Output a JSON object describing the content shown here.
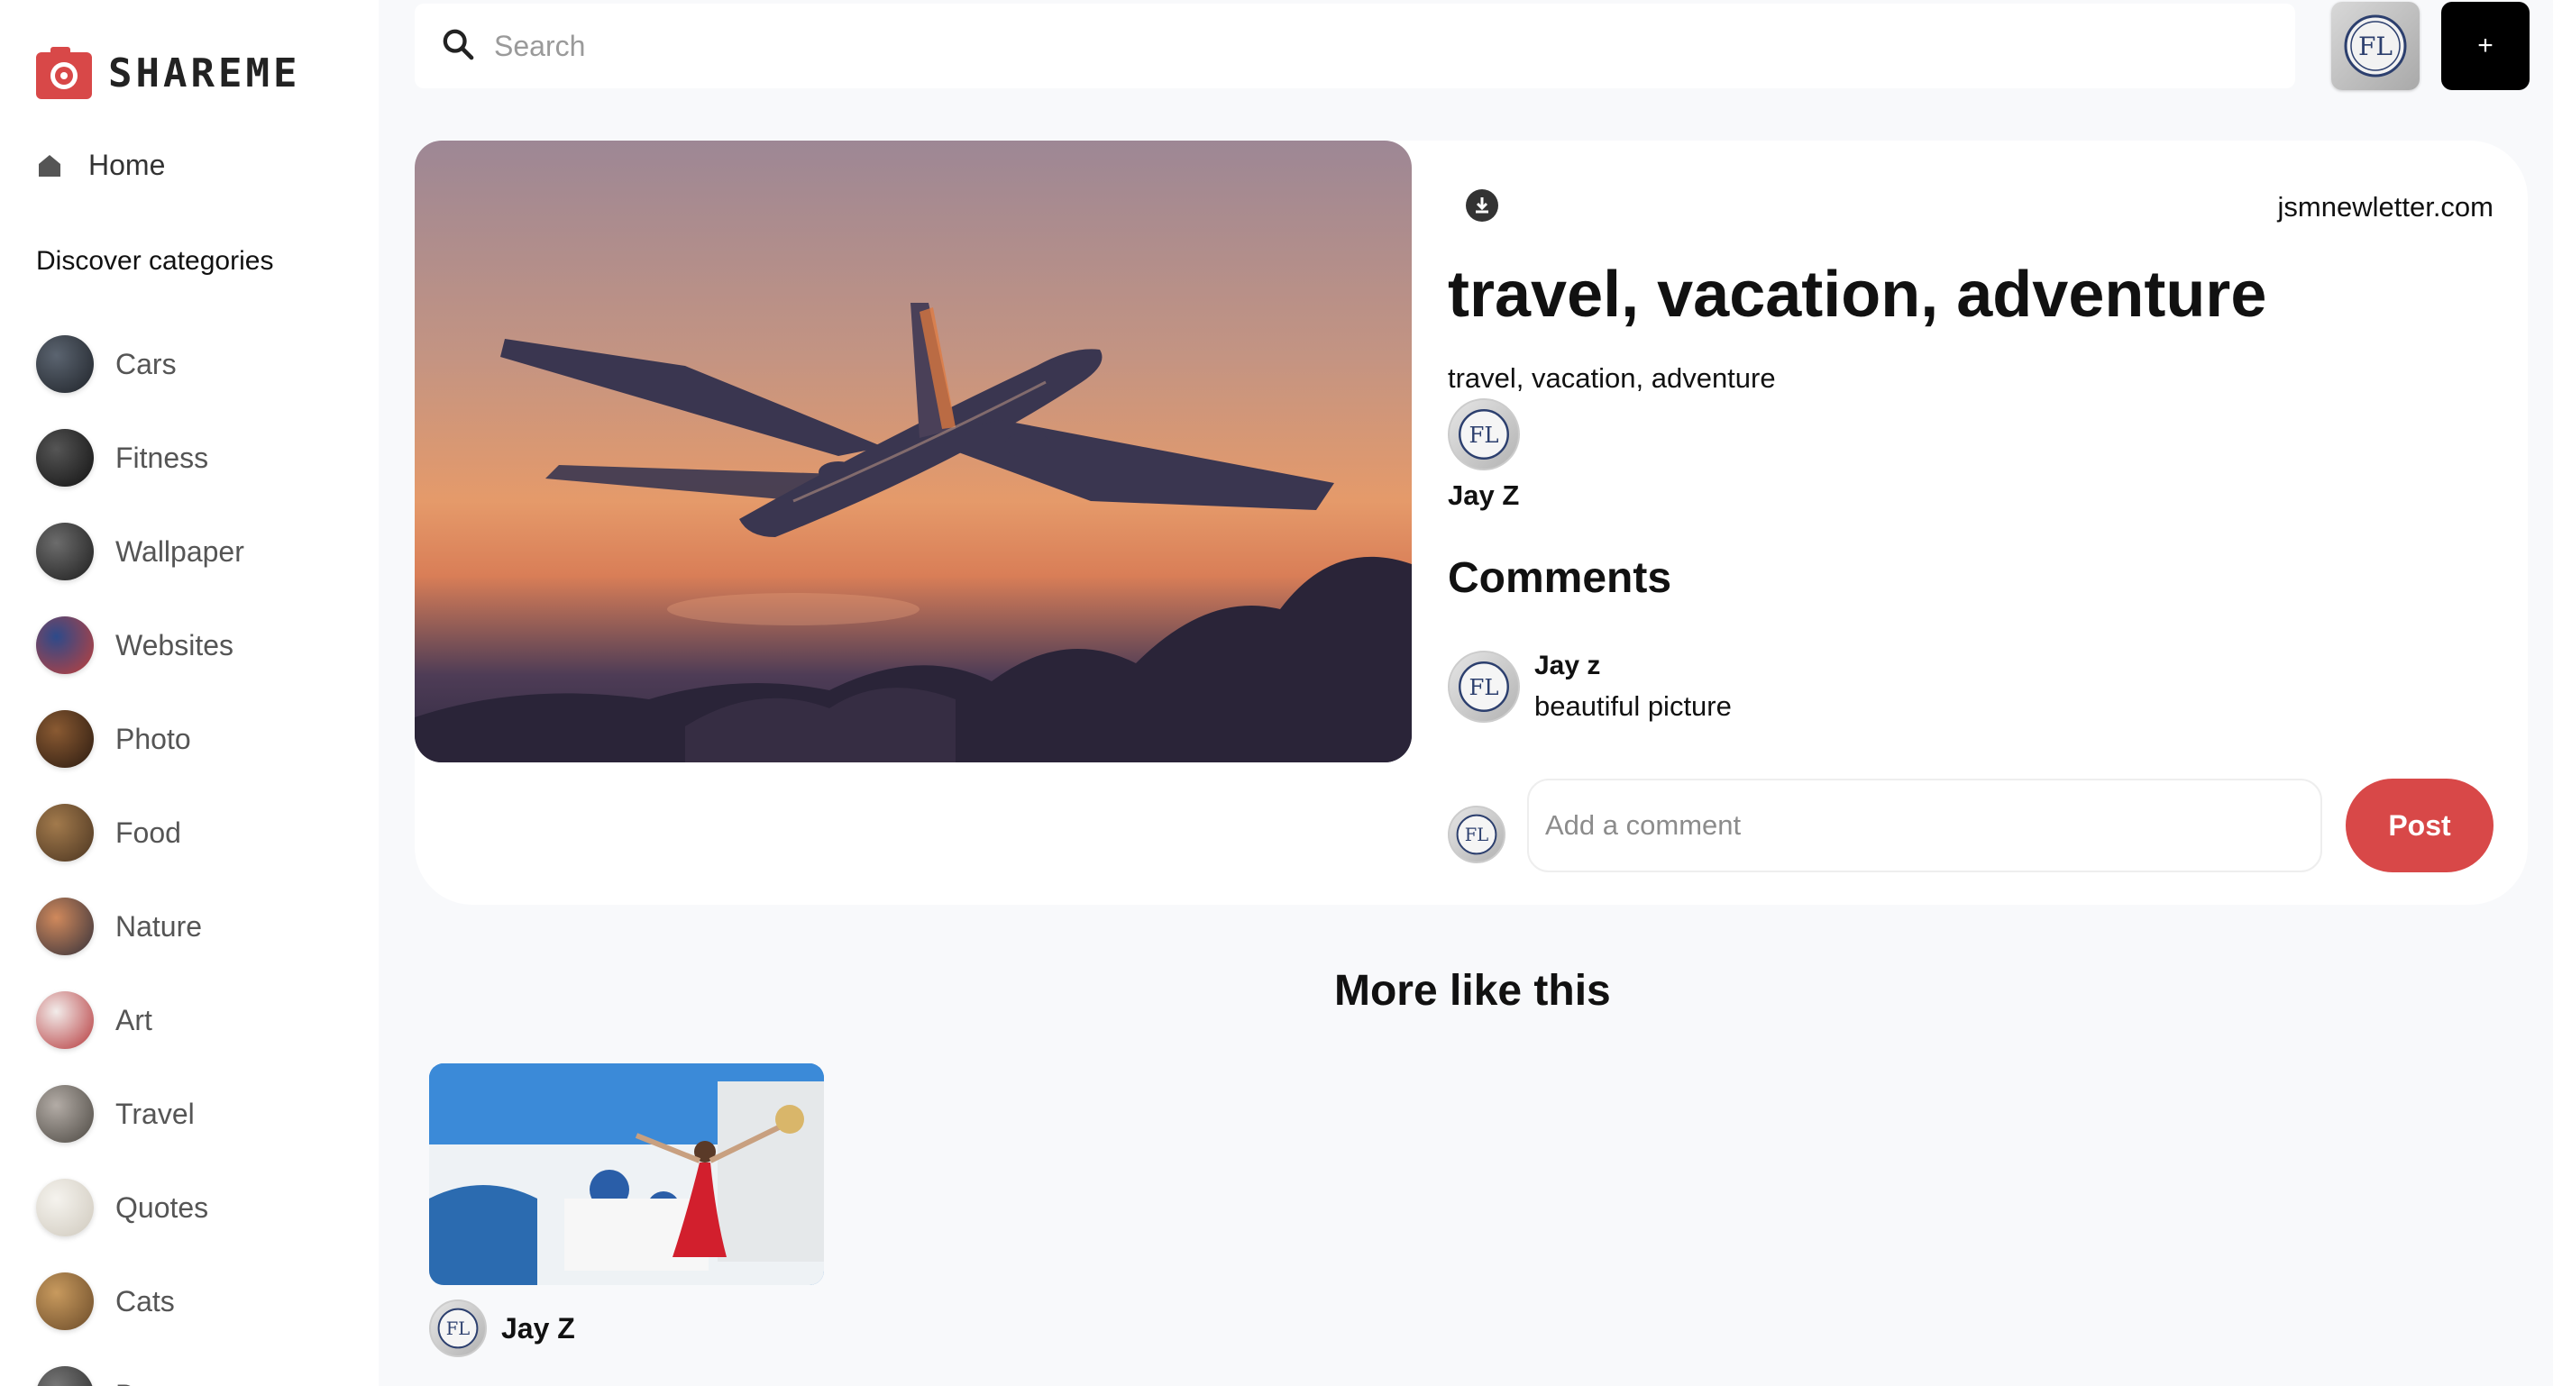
{
  "brand": {
    "name": "SHAREME",
    "accent": "#d84848"
  },
  "nav": {
    "home_label": "Home",
    "discover_label": "Discover categories"
  },
  "categories": [
    {
      "label": "Cars",
      "colors": [
        "#5b6470",
        "#1f2329"
      ]
    },
    {
      "label": "Fitness",
      "colors": [
        "#555555",
        "#111111"
      ]
    },
    {
      "label": "Wallpaper",
      "colors": [
        "#6c6c6c",
        "#1d1d1d"
      ]
    },
    {
      "label": "Websites",
      "colors": [
        "#2d4a8a",
        "#c2403a"
      ]
    },
    {
      "label": "Photo",
      "colors": [
        "#8a5a32",
        "#2a1a10"
      ]
    },
    {
      "label": "Food",
      "colors": [
        "#a27a4c",
        "#4a3420"
      ]
    },
    {
      "label": "Nature",
      "colors": [
        "#d0895c",
        "#33303a"
      ]
    },
    {
      "label": "Art",
      "colors": [
        "#f2ecea",
        "#b5373a"
      ]
    },
    {
      "label": "Travel",
      "colors": [
        "#b3aca6",
        "#4b4741"
      ]
    },
    {
      "label": "Quotes",
      "colors": [
        "#f5f3ee",
        "#cfc9bd"
      ]
    },
    {
      "label": "Cats",
      "colors": [
        "#c89a5e",
        "#6a4a28"
      ]
    },
    {
      "label": "Dogs",
      "colors": [
        "#777777",
        "#2a2a2a"
      ]
    }
  ],
  "search": {
    "placeholder": "Search"
  },
  "header": {
    "add_label": "+",
    "avatar_initials": "FL"
  },
  "pin": {
    "destination": "jsmnewletter.com",
    "title": "travel, vacation, adventure",
    "about": "travel, vacation, adventure",
    "author": "Jay Z",
    "image_icon": "airplane-icon"
  },
  "comments": {
    "title": "Comments",
    "items": [
      {
        "user": "Jay z",
        "text": "beautiful picture"
      }
    ],
    "input_placeholder": "Add a comment",
    "post_label": "Post"
  },
  "more": {
    "title": "More like this",
    "pins": [
      {
        "author": "Jay Z"
      }
    ]
  }
}
